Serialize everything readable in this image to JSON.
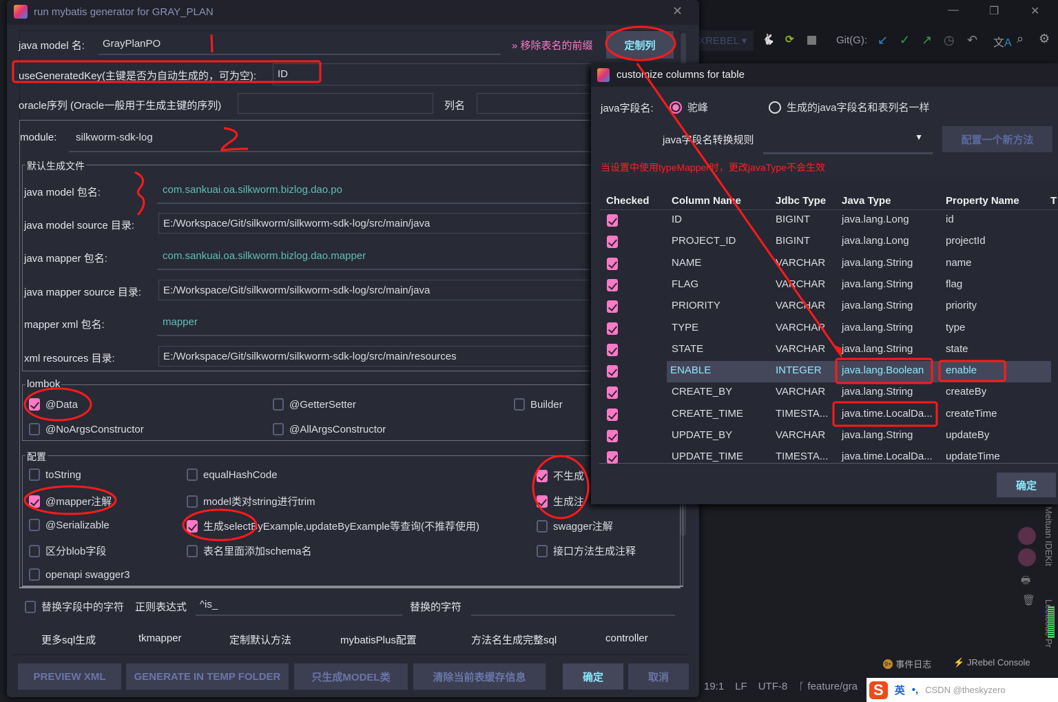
{
  "ide": {
    "rebel_label": "XREBEL",
    "git_label": "Git(G):",
    "side_tool": "Meituan IDEKit",
    "side_tool2": "Leetcode Pr",
    "event_log": "事件日志",
    "event_badge": "9+",
    "jrebel_console": "JRebel Console",
    "status": {
      "position": "19:1",
      "line_sep": "LF",
      "encoding": "UTF-8",
      "branch": "feature/gra"
    },
    "ime": {
      "lang": "英",
      "punct": "•,",
      "watermark": "CSDN @theskyzero"
    }
  },
  "dialog": {
    "title": "run mybatis generator for GRAY_PLAN",
    "model_name_label": "java model 名:",
    "model_name_value": "GrayPlanPO",
    "remove_prefix_label": "» 移除表名的前缀",
    "customize_columns_btn": "定制列",
    "use_generated_key_label": "useGeneratedKey(主键是否为自动生成的，可为空):",
    "use_generated_key_value": "ID",
    "oracle_seq_label": "oracle序列 (Oracle一般用于生成主键的序列)",
    "oracle_seq_value": "",
    "column_name_label": "列名",
    "column_name_value": "",
    "module_label": "module:",
    "module_value": "silkworm-sdk-log",
    "default_files_legend": "默认生成文件",
    "paths": [
      {
        "label": "java model 包名:",
        "value": "com.sankuai.oa.silkworm.bizlog.dao.po",
        "boxed": false
      },
      {
        "label": "java model source 目录:",
        "value": "E:/Workspace/Git/silkworm/silkworm-sdk-log/src/main/java",
        "boxed": true
      },
      {
        "label": "java mapper 包名:",
        "value": "com.sankuai.oa.silkworm.bizlog.dao.mapper",
        "boxed": false
      },
      {
        "label": "java mapper source 目录:",
        "value": "E:/Workspace/Git/silkworm/silkworm-sdk-log/src/main/java",
        "boxed": true
      },
      {
        "label": "mapper xml 包名:",
        "value": "mapper",
        "boxed": false
      },
      {
        "label": "xml resources 目录:",
        "value": "E:/Workspace/Git/silkworm/silkworm-sdk-log/src/main/resources",
        "boxed": true
      }
    ],
    "lombok_legend": "lombok",
    "lombok": [
      {
        "label": "@Data",
        "checked": true
      },
      {
        "label": "@GetterSetter",
        "checked": false
      },
      {
        "label": "Builder",
        "checked": false
      },
      {
        "label": "@NoArgsConstructor",
        "checked": false
      },
      {
        "label": "@AllArgsConstructor",
        "checked": false
      }
    ],
    "config_legend": "配置",
    "config": [
      {
        "label": "toString",
        "checked": false
      },
      {
        "label": "equalHashCode",
        "checked": false
      },
      {
        "label": "不生成",
        "checked": true
      },
      {
        "label": "@mapper注解",
        "checked": true
      },
      {
        "label": "model类对string进行trim",
        "checked": false
      },
      {
        "label": "生成注",
        "checked": true
      },
      {
        "label": "@Serializable",
        "checked": false
      },
      {
        "label": "生成selectByExample,updateByExample等查询(不推荐使用)",
        "checked": true
      },
      {
        "label": "swagger注解",
        "checked": false
      },
      {
        "label": "区分blob字段",
        "checked": false
      },
      {
        "label": "表名里面添加schema名",
        "checked": false
      },
      {
        "label": "接口方法生成注释",
        "checked": false
      },
      {
        "label": "openapi swagger3",
        "checked": false
      }
    ],
    "replace": {
      "checkbox_label": "替换字段中的字符",
      "checked": false,
      "regex_label": "正则表达式",
      "regex_value": "^is_",
      "replace_label": "替换的字符",
      "replace_value": ""
    },
    "tabs": [
      "更多sql生成",
      "tkmapper",
      "定制默认方法",
      "mybatisPlus配置",
      "方法名生成完整sql",
      "controller"
    ],
    "buttons": [
      "PREVIEW XML",
      "GENERATE IN TEMP FOLDER",
      "只生成MODEL类",
      "清除当前表缓存信息",
      "确定",
      "取消"
    ]
  },
  "columns_dialog": {
    "title": "customize columns for table",
    "field_name_label": "java字段名:",
    "radio_camel": "驼峰",
    "radio_camel_selected": true,
    "radio_same": "生成的java字段名和表列名一样",
    "rule_select": "java字段名转换规则",
    "new_method_btn": "配置一个新方法",
    "warning": "当设置中使用typeMapper时，更改javaType不会生效",
    "warning_color": "#ff2020",
    "headers": [
      "Checked",
      "Column Name",
      "Jdbc Type",
      "Java Type",
      "Property Name",
      "T"
    ],
    "rows": [
      {
        "checked": true,
        "column": "ID",
        "jdbc": "BIGINT",
        "java": "java.lang.Long",
        "prop": "id"
      },
      {
        "checked": true,
        "column": "PROJECT_ID",
        "jdbc": "BIGINT",
        "java": "java.lang.Long",
        "prop": "projectId"
      },
      {
        "checked": true,
        "column": "NAME",
        "jdbc": "VARCHAR",
        "java": "java.lang.String",
        "prop": "name"
      },
      {
        "checked": true,
        "column": "FLAG",
        "jdbc": "VARCHAR",
        "java": "java.lang.String",
        "prop": "flag"
      },
      {
        "checked": true,
        "column": "PRIORITY",
        "jdbc": "VARCHAR",
        "java": "java.lang.String",
        "prop": "priority"
      },
      {
        "checked": true,
        "column": "TYPE",
        "jdbc": "VARCHAR",
        "java": "java.lang.String",
        "prop": "type"
      },
      {
        "checked": true,
        "column": "STATE",
        "jdbc": "VARCHAR",
        "java": "java.lang.String",
        "prop": "state"
      },
      {
        "checked": true,
        "column": "ENABLE",
        "jdbc": "INTEGER",
        "java": "java.lang.Boolean",
        "prop": "enable",
        "selected": true
      },
      {
        "checked": true,
        "column": "CREATE_BY",
        "jdbc": "VARCHAR",
        "java": "java.lang.String",
        "prop": "createBy"
      },
      {
        "checked": true,
        "column": "CREATE_TIME",
        "jdbc": "TIMESTA...",
        "java": "java.time.LocalDa...",
        "prop": "createTime"
      },
      {
        "checked": true,
        "column": "UPDATE_BY",
        "jdbc": "VARCHAR",
        "java": "java.lang.String",
        "prop": "updateBy"
      },
      {
        "checked": true,
        "column": "UPDATE_TIME",
        "jdbc": "TIMESTA...",
        "java": "java.time.LocalDa...",
        "prop": "updateTime"
      }
    ],
    "ok_btn": "确定"
  },
  "annotations": {
    "color": "#ff1a1a",
    "marks": [
      "1",
      "2",
      "3"
    ]
  }
}
